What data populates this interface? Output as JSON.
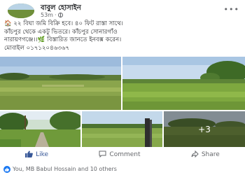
{
  "post": {
    "author": "বাবুল হোসাইন",
    "timestamp": "53m",
    "more_label": "•••",
    "text_lines": [
      "🏠 ২২ বিঘা জমি বিক্রি হবে। ৪০ ফিট রাস্তা সাথে।",
      "কাঁচপুর থেকে একটু ভিতরে। কাঁচপুর সোনারগাঁও",
      "নারায়ণগঞ্জে।।🌿 বিস্তারিত জানতে ইনবক্স করেন।",
      "মোবাইল ০১৭১২০৪৬৩৬৭"
    ],
    "photos_more_count": "+3"
  },
  "actions": {
    "like": "Like",
    "comment": "Comment",
    "share": "Share"
  },
  "reactions": {
    "summary": "You, MB Babul Hossain and 10 others"
  },
  "colors": {
    "like_blue": "#385898",
    "reaction_blue": "#1877f2",
    "meta_gray": "#65676b"
  },
  "icons": {
    "globe": "globe-icon",
    "more": "more-icon",
    "like": "like-icon",
    "comment": "comment-icon",
    "share": "share-icon"
  }
}
